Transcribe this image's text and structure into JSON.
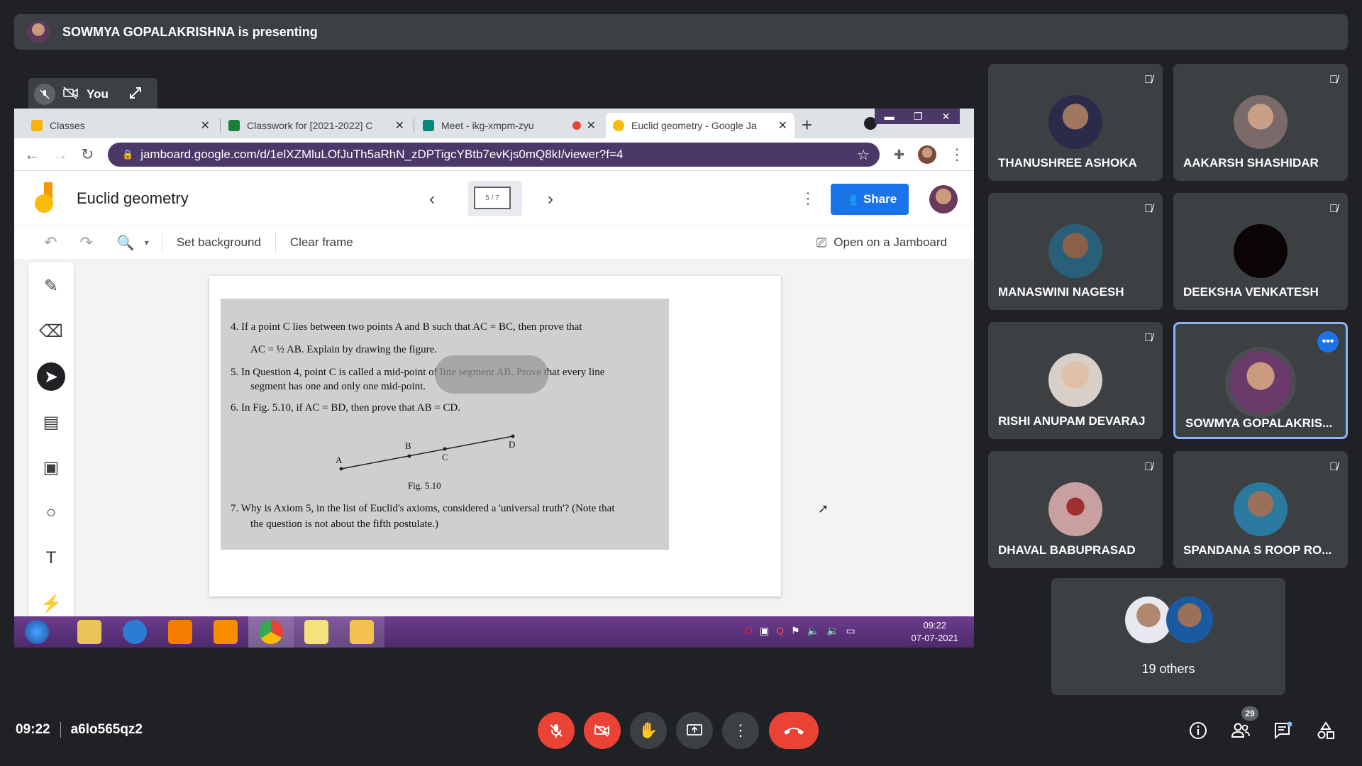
{
  "banner": {
    "text": "SOWMYA GOPALAKRISHNA is presenting"
  },
  "self_view": {
    "label": "You"
  },
  "browser": {
    "tabs": [
      {
        "title": "Classes",
        "color": "#f4b400"
      },
      {
        "title": "Classwork for [2021-2022] C",
        "color": "#188038"
      },
      {
        "title": "Meet - ikg-xmpm-zyu",
        "color": "#00897b"
      },
      {
        "title": "Euclid geometry - Google Ja",
        "color": "#fbbc04"
      }
    ],
    "url": "jamboard.google.com/d/1elXZMluLOfJuTh5aRhN_zDPTigcYBtb7evKjs0mQ8kI/viewer?f=4"
  },
  "jamboard": {
    "title": "Euclid geometry",
    "frame_indicator": "5 / 7",
    "share_label": "Share",
    "toolbar": {
      "set_background": "Set background",
      "clear_frame": "Clear frame",
      "open_on_jamboard": "Open on a Jamboard"
    }
  },
  "page_text": {
    "q4a": "4.   If a point C lies between two points A and B such that AC = BC, then prove that",
    "q4b": "AC = ½ AB. Explain by drawing the figure.",
    "q5a": "5.   In Question 4, point C is called a mid-point of line segment AB. Prove that every line",
    "q5b": "segment has one and only one mid-point.",
    "q6": "6.   In Fig. 5.10, if AC = BD, then prove that AB = CD.",
    "fig_caption": "Fig. 5.10",
    "pt_a": "A",
    "pt_b": "B",
    "pt_c": "C",
    "pt_d": "D",
    "q7a": "7.   Why is Axiom 5, in the list of Euclid's axioms, considered a 'universal truth'? (Note that",
    "q7b": "the question is not about the fifth postulate.)"
  },
  "taskbar": {
    "time": "09:22",
    "date": "07-07-2021"
  },
  "participants": [
    {
      "name": "THANUSHREE ASHOKA",
      "face": "#6b4a3a"
    },
    {
      "name": "AAKARSH SHASHIDAR",
      "face": "#b08a74"
    },
    {
      "name": "MANASWINI NAGESH",
      "face": "#3a5f7a"
    },
    {
      "name": "DEEKSHA VENKATESH",
      "face": "#0a0404"
    },
    {
      "name": "RISHI ANUPAM DEVARAJ",
      "face": "#d8c8b8"
    },
    {
      "name": "SOWMYA GOPALAKRIS...",
      "face": "#7a5a6a"
    },
    {
      "name": "DHAVAL BABUPRASAD",
      "face": "#c9a0a0"
    },
    {
      "name": "SPANDANA S ROOP RO...",
      "face": "#2a7aa0"
    }
  ],
  "others": {
    "label": "19 others"
  },
  "meeting": {
    "time": "09:22",
    "code": "a6lo565qz2",
    "participant_count": "29"
  }
}
